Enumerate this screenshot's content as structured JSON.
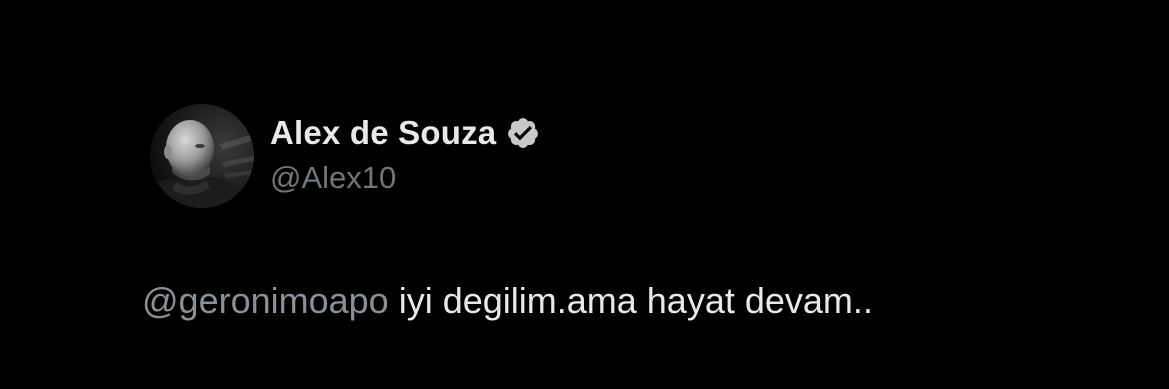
{
  "tweet": {
    "author": {
      "display_name": "Alex de Souza",
      "handle": "@Alex10",
      "verified": true,
      "avatar_icon": "profile-photo",
      "verified_icon": "verified-badge-icon"
    },
    "body": {
      "mention": "@geronimoapo",
      "text": " iyi degilim.ama hayat devam.."
    }
  },
  "colors": {
    "background": "#000000",
    "name": "#e7e9ea",
    "handle": "#71767b",
    "mention": "#8b9096",
    "verified_badge": "#c8c8c8"
  }
}
